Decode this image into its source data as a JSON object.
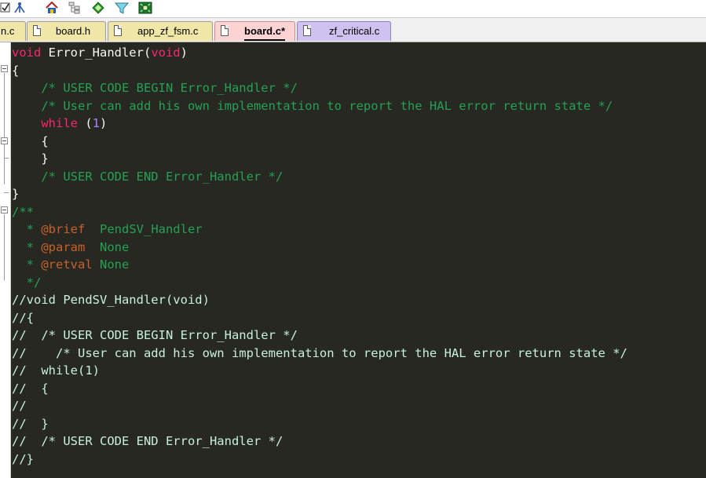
{
  "toolbar": {
    "buttons": [
      {
        "name": "checkbox-icon"
      },
      {
        "name": "network-icon"
      },
      {
        "name": "home-icon"
      },
      {
        "name": "hierarchy-icon"
      },
      {
        "name": "diamond-icon"
      },
      {
        "name": "funnel-icon"
      },
      {
        "name": "layout-icon"
      }
    ]
  },
  "tabs": [
    {
      "label": "n.c",
      "active": false
    },
    {
      "label": "board.h",
      "active": false
    },
    {
      "label": "app_zf_fsm.c",
      "active": false
    },
    {
      "label": "board.c*",
      "active": true
    },
    {
      "label": "zf_critical.c",
      "active": false
    }
  ],
  "editor": {
    "lines": [
      [
        {
          "t": "void",
          "c": "kw"
        },
        {
          "t": " Error_Handler(",
          "c": "pl"
        },
        {
          "t": "void",
          "c": "kw"
        },
        {
          "t": ")",
          "c": "pl"
        }
      ],
      [
        {
          "t": "{",
          "c": "pl"
        }
      ],
      [
        {
          "t": "    /* USER CODE BEGIN Error_Handler */",
          "c": "cm"
        }
      ],
      [
        {
          "t": "    /* User can add his own implementation to report the HAL error return state */",
          "c": "cm"
        }
      ],
      [
        {
          "t": "    ",
          "c": "pl"
        },
        {
          "t": "while",
          "c": "kw"
        },
        {
          "t": " (",
          "c": "pl"
        },
        {
          "t": "1",
          "c": "num"
        },
        {
          "t": ")",
          "c": "pl"
        }
      ],
      [
        {
          "t": "    {",
          "c": "pl"
        }
      ],
      [
        {
          "t": "    }",
          "c": "pl"
        }
      ],
      [
        {
          "t": "    /* USER CODE END Error_Handler */",
          "c": "cm"
        }
      ],
      [
        {
          "t": "}",
          "c": "pl"
        }
      ],
      [
        {
          "t": "/**",
          "c": "cm"
        }
      ],
      [
        {
          "t": "  * ",
          "c": "cm"
        },
        {
          "t": "@brief",
          "c": "tag"
        },
        {
          "t": "  PendSV_Handler",
          "c": "cm"
        }
      ],
      [
        {
          "t": "  * ",
          "c": "cm"
        },
        {
          "t": "@param",
          "c": "tag"
        },
        {
          "t": "  None",
          "c": "cm"
        }
      ],
      [
        {
          "t": "  * ",
          "c": "cm"
        },
        {
          "t": "@retval",
          "c": "tag"
        },
        {
          "t": " None",
          "c": "cm"
        }
      ],
      [
        {
          "t": "  */",
          "c": "cm"
        }
      ],
      [
        {
          "t": "//void PendSV_Handler(void)",
          "c": "sc"
        }
      ],
      [
        {
          "t": "//{",
          "c": "sc"
        }
      ],
      [
        {
          "t": "//  /* USER CODE BEGIN Error_Handler */",
          "c": "sc"
        }
      ],
      [
        {
          "t": "//    /* User can add his own implementation to report the HAL error return state */",
          "c": "sc"
        }
      ],
      [
        {
          "t": "//  while(1)",
          "c": "sc"
        }
      ],
      [
        {
          "t": "//  {",
          "c": "sc"
        }
      ],
      [
        {
          "t": "//",
          "c": "sc"
        }
      ],
      [
        {
          "t": "//  }",
          "c": "sc"
        }
      ],
      [
        {
          "t": "//  /* USER CODE END Error_Handler */",
          "c": "sc"
        }
      ],
      [
        {
          "t": "//}",
          "c": "sc"
        }
      ]
    ]
  },
  "colors": {
    "editor_bg": "#272822",
    "keyword": "#f92672",
    "number": "#ae81ff",
    "comment": "#25a054",
    "doc_tag": "#c8602b",
    "line_comment": "#c7f0e0",
    "tab_active": "#fcd3d3",
    "tab_inactive": "#efe6a8",
    "tab_last": "#cfc2ef"
  }
}
